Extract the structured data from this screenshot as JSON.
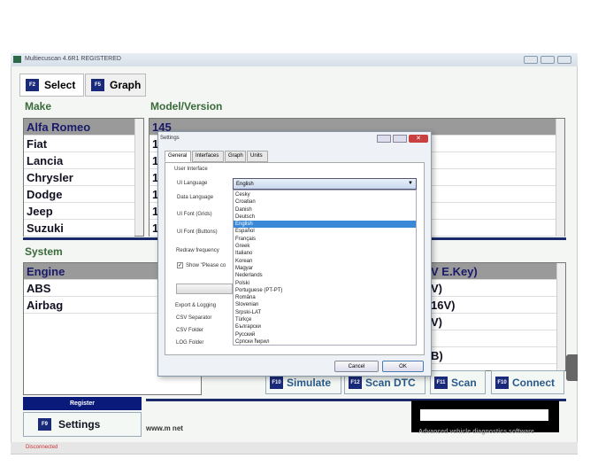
{
  "window": {
    "title": "Multiecuscan 4.6R1 REGISTERED"
  },
  "tabs": [
    {
      "key": "F2",
      "label": "Select"
    },
    {
      "key": "F5",
      "label": "Graph"
    }
  ],
  "make": {
    "label": "Make",
    "items": [
      "Alfa Romeo",
      "Fiat",
      "Lancia",
      "Chrysler",
      "Dodge",
      "Jeep",
      "Suzuki"
    ],
    "selected": "Alfa Romeo"
  },
  "model": {
    "label": "Model/Version",
    "items": [
      "145",
      "1",
      "1",
      "1",
      "1",
      "1",
      "1"
    ]
  },
  "system": {
    "label": "System",
    "items": [
      "Engine",
      "ABS",
      "Airbag"
    ],
    "selected": "Engine"
  },
  "versions": {
    "items": [
      "V E.Key)",
      "V)",
      "16V)",
      "V)",
      "",
      "B)"
    ]
  },
  "buttons": {
    "simulate": {
      "key": "F10",
      "label": "Simulate"
    },
    "scan_dtc": {
      "key": "F12",
      "label": "Scan DTC"
    },
    "scan": {
      "key": "F11",
      "label": "Scan"
    },
    "connect": {
      "key": "F10",
      "label": "Connect"
    },
    "register": "Register",
    "settings": {
      "key": "F9",
      "label": "Settings"
    }
  },
  "footer": {
    "url": "www.m            net",
    "tagline": "Advanced vehicle diagnostics software",
    "status": "Disconnected"
  },
  "dialog": {
    "title": "Settings",
    "tabs": [
      "General",
      "Interfaces",
      "Graph",
      "Units"
    ],
    "group": "User Interface",
    "labels": {
      "ui_language": "UI Language",
      "data_language": "Data Language",
      "ui_font_grids": "UI Font (Grids)",
      "ui_font_buttons": "UI Font (Buttons)",
      "redraw": "Redraw frequency",
      "show_please": "Show \"Please co",
      "export": "Export & Logging",
      "csv_sep": "CSV Separator",
      "csv_folder": "CSV Folder",
      "log_folder": "LOG Folder"
    },
    "ui_language_value": "English",
    "languages": [
      "Cesky",
      "Croatian",
      "Danish",
      "Deutsch",
      "English",
      "Español",
      "Français",
      "Greek",
      "Italiano",
      "Korean",
      "Magyar",
      "Nederlands",
      "Polski",
      "Portuguese (PT-PT)",
      "Româna",
      "Slovenian",
      "Srpski-LAT",
      "Türkçe",
      "Български",
      "Русский",
      "Српски ћирил"
    ],
    "selected_language": "English",
    "cancel": "Cancel",
    "ok": "OK"
  }
}
